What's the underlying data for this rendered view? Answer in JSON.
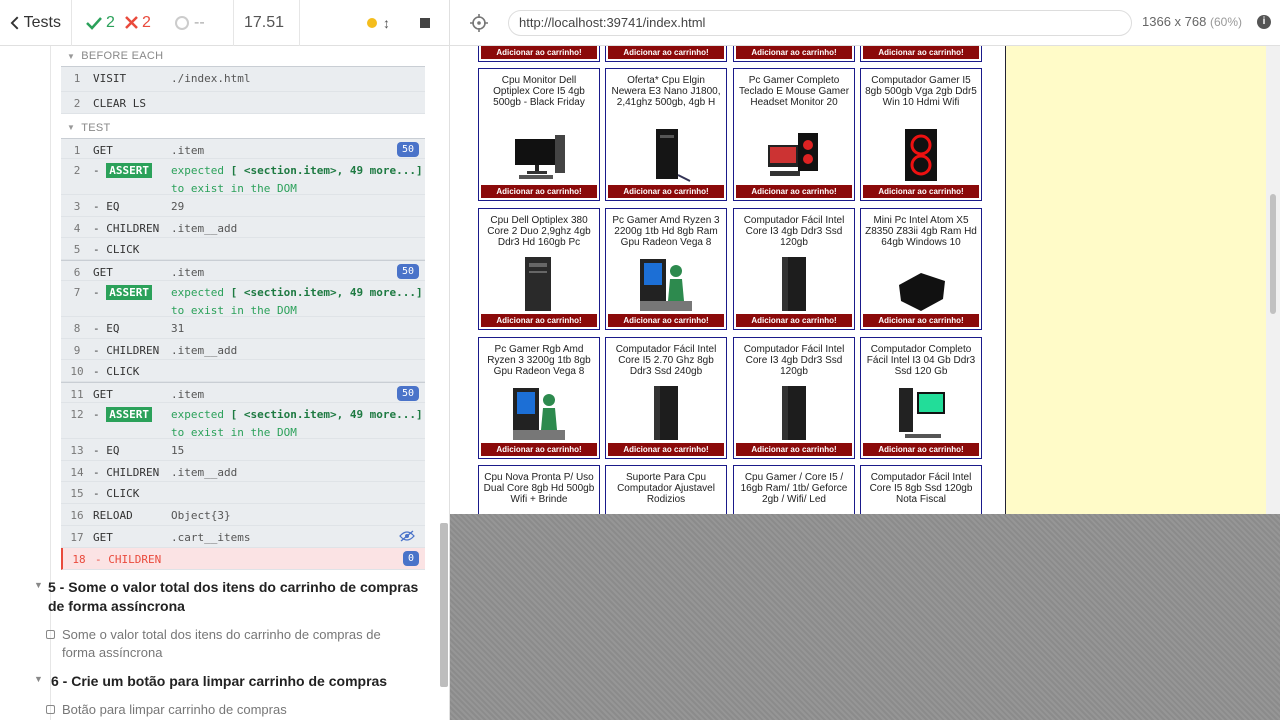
{
  "stats": {
    "tests_label": "Tests",
    "passed": "2",
    "failed": "2",
    "pending": "--",
    "duration": "17.51"
  },
  "command_log": {
    "before_each_label": "BEFORE EACH",
    "test_label": "TEST",
    "before_each": [
      {
        "num": "1",
        "name": "VISIT",
        "msg": "./index.html"
      },
      {
        "num": "2",
        "name": "CLEAR LS",
        "msg": ""
      }
    ],
    "commands": [
      {
        "num": "1",
        "name": "GET",
        "msg": ".item",
        "badge": "50"
      },
      {
        "num": "2",
        "name": "- ASSERT",
        "assert": "ASSERT",
        "msg_a": "expected ",
        "msg_b": "[ <section.item>, 49 more...",
        "msg_c": "] ",
        "msg_d": "to exist in the DOM"
      },
      {
        "num": "3",
        "name": "- EQ",
        "msg": "29"
      },
      {
        "num": "4",
        "name": "- CHILDREN",
        "msg": ".item__add"
      },
      {
        "num": "5",
        "name": "- CLICK",
        "msg": ""
      },
      {
        "num": "6",
        "name": "GET",
        "msg": ".item",
        "badge": "50"
      },
      {
        "num": "7",
        "name": "- ASSERT",
        "assert": "ASSERT",
        "msg_a": "expected ",
        "msg_b": "[ <section.item>, 49 more...",
        "msg_c": "] ",
        "msg_d": "to exist in the DOM"
      },
      {
        "num": "8",
        "name": "- EQ",
        "msg": "31"
      },
      {
        "num": "9",
        "name": "- CHILDREN",
        "msg": ".item__add"
      },
      {
        "num": "10",
        "name": "- CLICK",
        "msg": ""
      },
      {
        "num": "11",
        "name": "GET",
        "msg": ".item",
        "badge": "50"
      },
      {
        "num": "12",
        "name": "- ASSERT",
        "assert": "ASSERT",
        "msg_a": "expected ",
        "msg_b": "[ <section.item>, 49 more...",
        "msg_c": "] ",
        "msg_d": "to exist in the DOM"
      },
      {
        "num": "13",
        "name": "- EQ",
        "msg": "15"
      },
      {
        "num": "14",
        "name": "- CHILDREN",
        "msg": ".item__add"
      },
      {
        "num": "15",
        "name": "- CLICK",
        "msg": ""
      },
      {
        "num": "16",
        "name": "RELOAD",
        "msg": "Object{3}"
      },
      {
        "num": "17",
        "name": "GET",
        "msg": ".cart__items"
      },
      {
        "num": "18",
        "name": "- CHILDREN",
        "msg": "",
        "badge": "0"
      }
    ]
  },
  "suites": [
    {
      "title": "5 - Some o valor total dos itens do carrinho de compras de forma assíncrona",
      "test": "Some o valor total dos itens do carrinho de compras de forma assíncrona"
    },
    {
      "title": "6 - Crie um botão para limpar carrinho de compras",
      "test": "Botão para limpar carrinho de compras"
    }
  ],
  "aut": {
    "url": "http://localhost:39741/index.html",
    "viewport": "1366 x 768",
    "zoom": "(60%)",
    "info": "i"
  },
  "products": {
    "add_label": "Adicionar ao carrinho!",
    "items": [
      {
        "title": "Cpu Monitor Dell Optiplex Core I5 4gb 500gb - Black Friday"
      },
      {
        "title": "Oferta* Cpu Elgin Newera E3 Nano J1800, 2,41ghz 500gb, 4gb H"
      },
      {
        "title": "Pc Gamer Completo Teclado E Mouse Gamer Headset Monitor 20"
      },
      {
        "title": "Computador Gamer I5 8gb 500gb Vga 2gb Ddr5 Win 10 Hdmi Wifi"
      },
      {
        "title": "Cpu Dell Optiplex 380 Core 2 Duo 2,9ghz 4gb Ddr3 Hd 160gb Pc"
      },
      {
        "title": "Pc Gamer Amd Ryzen 3 2200g 1tb Hd 8gb Ram Gpu Radeon Vega 8"
      },
      {
        "title": "Computador Fácil Intel Core I3 4gb Ddr3 Ssd 120gb"
      },
      {
        "title": "Mini Pc Intel Atom X5 Z8350 Z83ii 4gb Ram Hd 64gb Windows 10"
      },
      {
        "title": "Pc Gamer Rgb Amd Ryzen 3 3200g 1tb 8gb Gpu Radeon Vega 8"
      },
      {
        "title": "Computador Fácil Intel Core I5 2.70 Ghz 8gb Ddr3 Ssd 240gb"
      },
      {
        "title": "Computador Fácil Intel Core I3 4gb Ddr3 Ssd 120gb"
      },
      {
        "title": "Computador Completo Fácil Intel I3 04 Gb Ddr3 Ssd 120 Gb"
      },
      {
        "title": "Cpu Nova Pronta P/ Uso Dual Core 8gb Hd 500gb Wifi + Brinde"
      },
      {
        "title": "Suporte Para Cpu Computador Ajustavel Rodizios"
      },
      {
        "title": "Cpu Gamer / Core I5 / 16gb Ram/ 1tb/ Geforce 2gb / Wifi/ Led"
      },
      {
        "title": "Computador Fácil Intel Core I5 8gb Ssd 120gb Nota Fiscal"
      }
    ]
  }
}
